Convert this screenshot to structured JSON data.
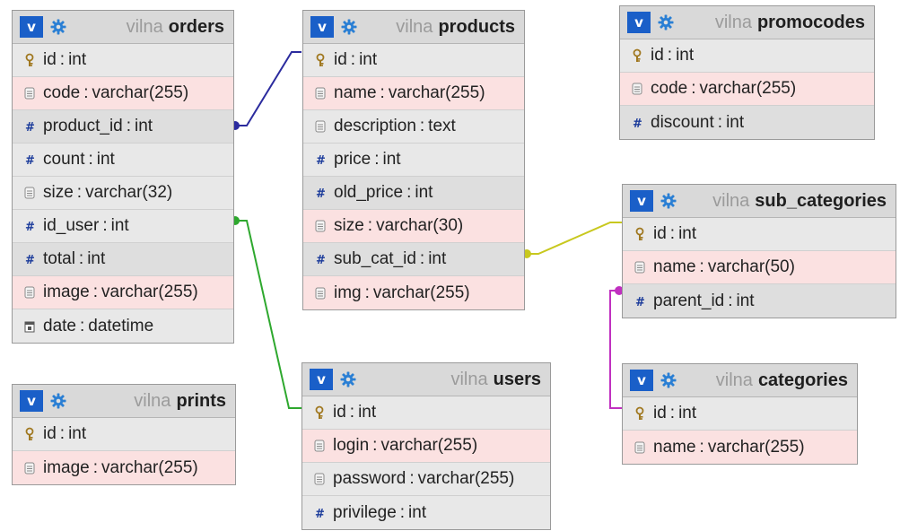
{
  "colors": {
    "accent": "#1a5fc8",
    "link_orders_products": "#2b2b9e",
    "link_orders_users": "#2ea82e",
    "link_products_subcats": "#c8c81e",
    "link_subcats_categories": "#c030c0"
  },
  "tables": {
    "orders": {
      "db": "vilna",
      "name": "orders",
      "columns": [
        {
          "name": "id",
          "type": "int",
          "icon": "key-icon"
        },
        {
          "name": "code",
          "type": "varchar(255)",
          "icon": "text-field-icon"
        },
        {
          "name": "product_id",
          "type": "int",
          "icon": "number-icon"
        },
        {
          "name": "count",
          "type": "int",
          "icon": "number-icon"
        },
        {
          "name": "size",
          "type": "varchar(32)",
          "icon": "text-field-icon"
        },
        {
          "name": "id_user",
          "type": "int",
          "icon": "number-icon"
        },
        {
          "name": "total",
          "type": "int",
          "icon": "number-icon"
        },
        {
          "name": "image",
          "type": "varchar(255)",
          "icon": "text-field-icon"
        },
        {
          "name": "date",
          "type": "datetime",
          "icon": "calendar-icon"
        }
      ]
    },
    "products": {
      "db": "vilna",
      "name": "products",
      "columns": [
        {
          "name": "id",
          "type": "int",
          "icon": "key-icon"
        },
        {
          "name": "name",
          "type": "varchar(255)",
          "icon": "text-field-icon"
        },
        {
          "name": "description",
          "type": "text",
          "icon": "text-field-icon"
        },
        {
          "name": "price",
          "type": "int",
          "icon": "number-icon"
        },
        {
          "name": "old_price",
          "type": "int",
          "icon": "number-icon"
        },
        {
          "name": "size",
          "type": "varchar(30)",
          "icon": "text-field-icon"
        },
        {
          "name": "sub_cat_id",
          "type": "int",
          "icon": "number-icon"
        },
        {
          "name": "img",
          "type": "varchar(255)",
          "icon": "text-field-icon"
        }
      ]
    },
    "promocodes": {
      "db": "vilna",
      "name": "promocodes",
      "columns": [
        {
          "name": "id",
          "type": "int",
          "icon": "key-icon"
        },
        {
          "name": "code",
          "type": "varchar(255)",
          "icon": "text-field-icon"
        },
        {
          "name": "discount",
          "type": "int",
          "icon": "number-icon"
        }
      ]
    },
    "sub_categories": {
      "db": "vilna",
      "name": "sub_categories",
      "columns": [
        {
          "name": "id",
          "type": "int",
          "icon": "key-icon"
        },
        {
          "name": "name",
          "type": "varchar(50)",
          "icon": "text-field-icon"
        },
        {
          "name": "parent_id",
          "type": "int",
          "icon": "number-icon"
        }
      ]
    },
    "categories": {
      "db": "vilna",
      "name": "categories",
      "columns": [
        {
          "name": "id",
          "type": "int",
          "icon": "key-icon"
        },
        {
          "name": "name",
          "type": "varchar(255)",
          "icon": "text-field-icon"
        }
      ]
    },
    "prints": {
      "db": "vilna",
      "name": "prints",
      "columns": [
        {
          "name": "id",
          "type": "int",
          "icon": "key-icon"
        },
        {
          "name": "image",
          "type": "varchar(255)",
          "icon": "text-field-icon"
        }
      ]
    },
    "users": {
      "db": "vilna",
      "name": "users",
      "columns": [
        {
          "name": "id",
          "type": "int",
          "icon": "key-icon"
        },
        {
          "name": "login",
          "type": "varchar(255)",
          "icon": "text-field-icon"
        },
        {
          "name": "password",
          "type": "varchar(255)",
          "icon": "text-field-icon"
        },
        {
          "name": "privilege",
          "type": "int",
          "icon": "number-icon"
        }
      ]
    }
  },
  "ui": {
    "toggle_label": "v",
    "separator": ":"
  }
}
